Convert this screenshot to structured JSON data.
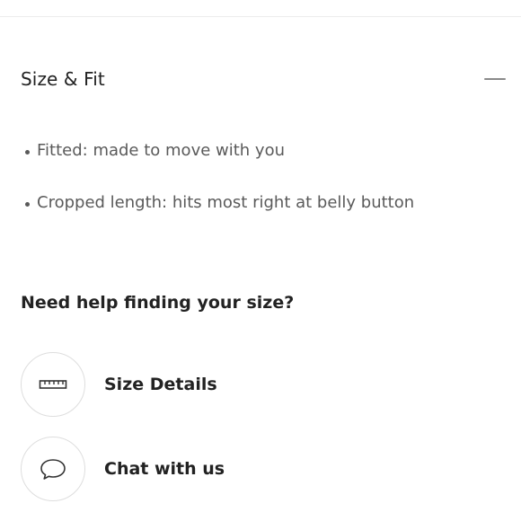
{
  "section": {
    "title": "Size & Fit",
    "collapse_icon": "minus-icon"
  },
  "bullets": [
    {
      "text": "Fitted: made to move with you"
    },
    {
      "text": "Cropped length: hits most right at belly button"
    }
  ],
  "help": {
    "title": "Need help finding your size?",
    "items": [
      {
        "label": "Size Details",
        "icon": "ruler-icon"
      },
      {
        "label": "Chat with us",
        "icon": "chat-bubble-icon"
      }
    ]
  },
  "colors": {
    "text_primary": "#222222",
    "text_secondary": "#5a5a5a",
    "divider": "#ececec",
    "circle_border": "#dedede"
  }
}
